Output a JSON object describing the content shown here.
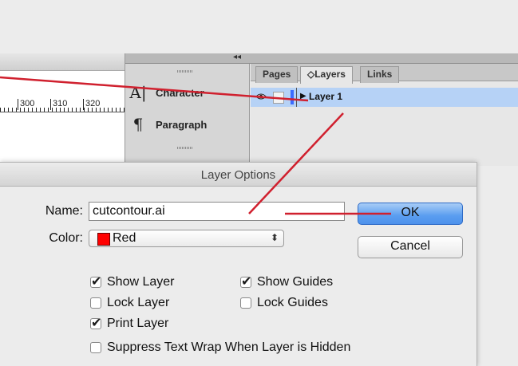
{
  "dock": {
    "collapse_icon": "double-chevron-left",
    "items": [
      {
        "icon": "A|",
        "label": "Character"
      },
      {
        "icon": "¶",
        "label": "Paragraph"
      }
    ]
  },
  "ruler": {
    "numbers": [
      "300",
      "310",
      "320"
    ]
  },
  "layers_panel": {
    "tabs": [
      {
        "label": "Pages"
      },
      {
        "label": "◇Layers"
      },
      {
        "label": "Links"
      }
    ],
    "layer_name": "Layer 1",
    "layer_color": "#3b6bff",
    "selection_color": "#b6d2f6"
  },
  "dialog": {
    "title": "Layer Options",
    "name_label": "Name:",
    "name_value": "cutcontour.ai",
    "color_label": "Color:",
    "color_value": "Red",
    "color_swatch": "#ff0000",
    "select_arrows": "⬍",
    "ok_label": "OK",
    "cancel_label": "Cancel",
    "checkboxes": [
      {
        "label": "Show Layer",
        "checked": true
      },
      {
        "label": "Show Guides",
        "checked": true
      },
      {
        "label": "Lock Layer",
        "checked": false
      },
      {
        "label": "Lock Guides",
        "checked": false
      },
      {
        "label": "Print Layer",
        "checked": true
      },
      {
        "label": "Suppress Text Wrap When Layer is Hidden",
        "checked": false
      }
    ]
  },
  "annotation_color": "#d0202e"
}
